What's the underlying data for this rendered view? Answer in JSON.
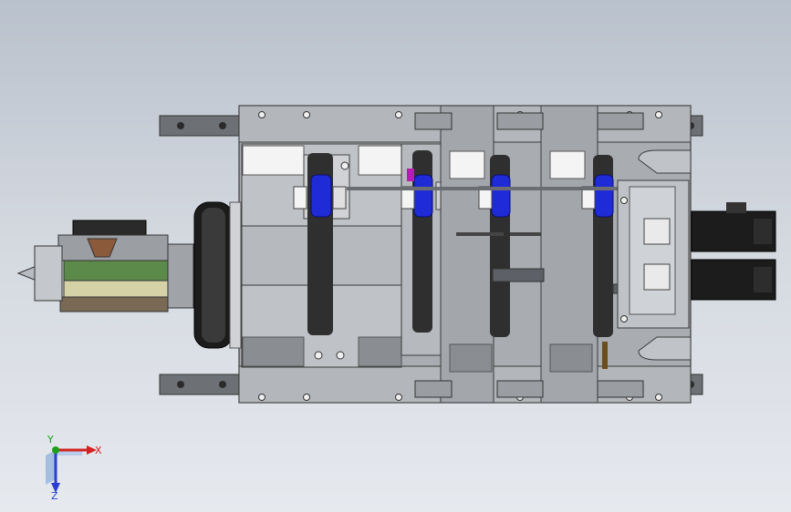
{
  "viewport": {
    "model": "mechanical-assembly",
    "view": "top-view",
    "colors": {
      "background_top": "#b9c1cc",
      "background_bottom": "#e6e9ee",
      "plate": "#a9acb1",
      "plate_dark": "#8e9196",
      "block": "#c9cbce",
      "white_block": "#f4f4f4",
      "rail": "#6d7075",
      "roller_blue": "#1f2bd6",
      "chain": "#2f2f2f",
      "motor": "#1c1c1c",
      "accent_green": "#5c8a4a",
      "accent_magenta": "#b21fb2"
    }
  },
  "triad": {
    "x_label": "X",
    "y_label": "Y",
    "z_label": "Z",
    "x_color": "#d42020",
    "y_color": "#1aa01a",
    "z_color": "#2a3fd0"
  }
}
